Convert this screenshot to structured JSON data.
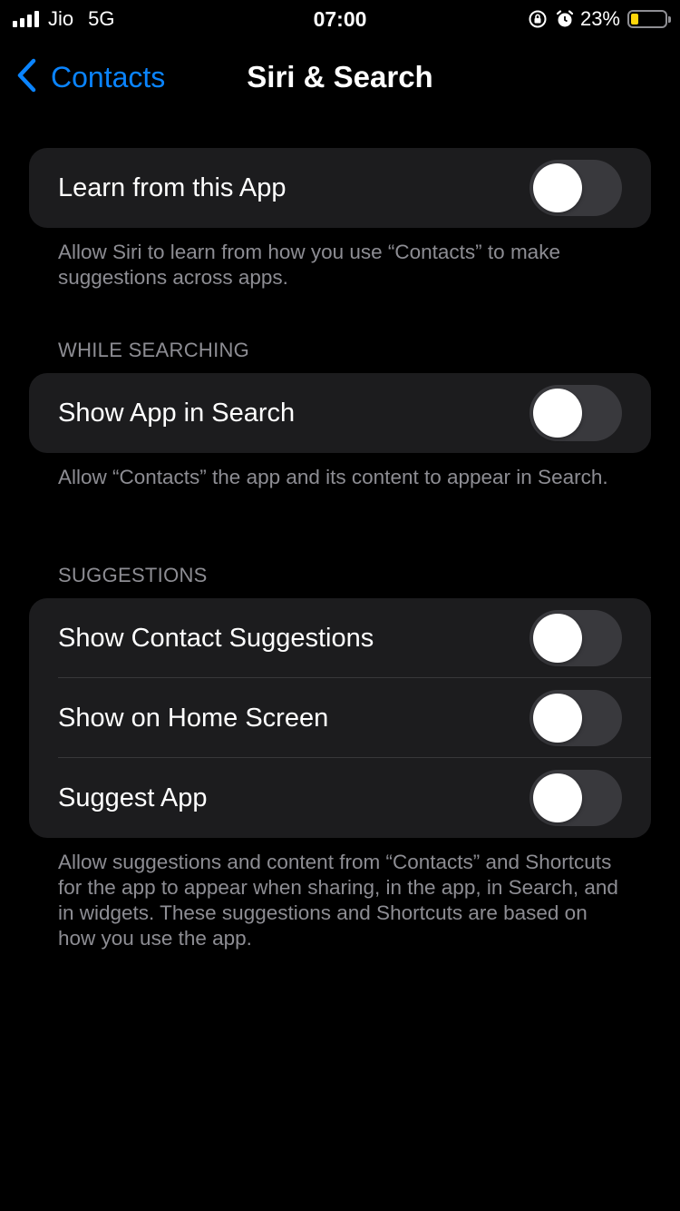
{
  "status_bar": {
    "carrier": "Jio",
    "network": "5G",
    "time": "07:00",
    "battery_percent": "23%",
    "battery_level": 0.23,
    "battery_color": "#ffd60a",
    "icons": [
      "signal-icon",
      "orientation-lock-icon",
      "alarm-icon",
      "battery-icon"
    ]
  },
  "nav": {
    "back_label": "Contacts",
    "title": "Siri & Search",
    "accent_color": "#0a84ff"
  },
  "learn_group": {
    "label": "Learn from this App",
    "enabled": false,
    "footnote": "Allow Siri to learn from how you use “Contacts” to make suggestions across apps."
  },
  "while_searching": {
    "header": "WHILE SEARCHING",
    "label": "Show App in Search",
    "enabled": false,
    "footnote": "Allow “Contacts” the app and its content to appear in Search."
  },
  "suggestions": {
    "header": "SUGGESTIONS",
    "rows": [
      {
        "label": "Show Contact Suggestions",
        "enabled": false
      },
      {
        "label": "Show on Home Screen",
        "enabled": false
      },
      {
        "label": "Suggest App",
        "enabled": false
      }
    ],
    "footnote": "Allow suggestions and content from “Contacts” and Shortcuts for the app to appear when sharing, in the app, in Search, and in widgets. These suggestions and Shortcuts are based on how you use the app."
  }
}
